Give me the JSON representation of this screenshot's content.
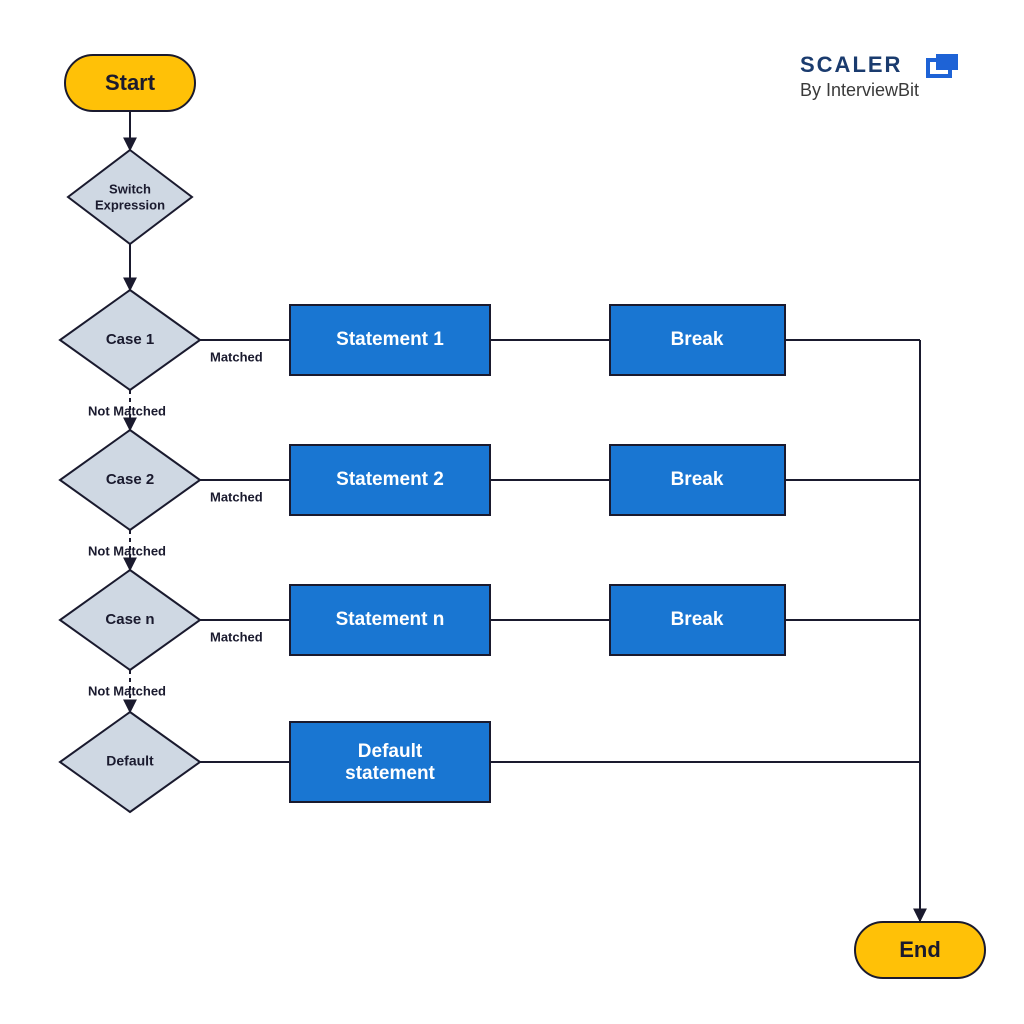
{
  "brand": {
    "title": "SCALER",
    "subtitle": "By InterviewBit"
  },
  "nodes": {
    "start": "Start",
    "switch_line1": "Switch",
    "switch_line2": "Expression",
    "case1": "Case 1",
    "case2": "Case 2",
    "casen": "Case n",
    "default": "Default",
    "stmt1": "Statement 1",
    "stmt2": "Statement 2",
    "stmtn": "Statement n",
    "default_stmt_line1": "Default",
    "default_stmt_line2": "statement",
    "break1": "Break",
    "break2": "Break",
    "break3": "Break",
    "end": "End"
  },
  "edges": {
    "matched": "Matched",
    "not_matched": "Not Matched"
  }
}
